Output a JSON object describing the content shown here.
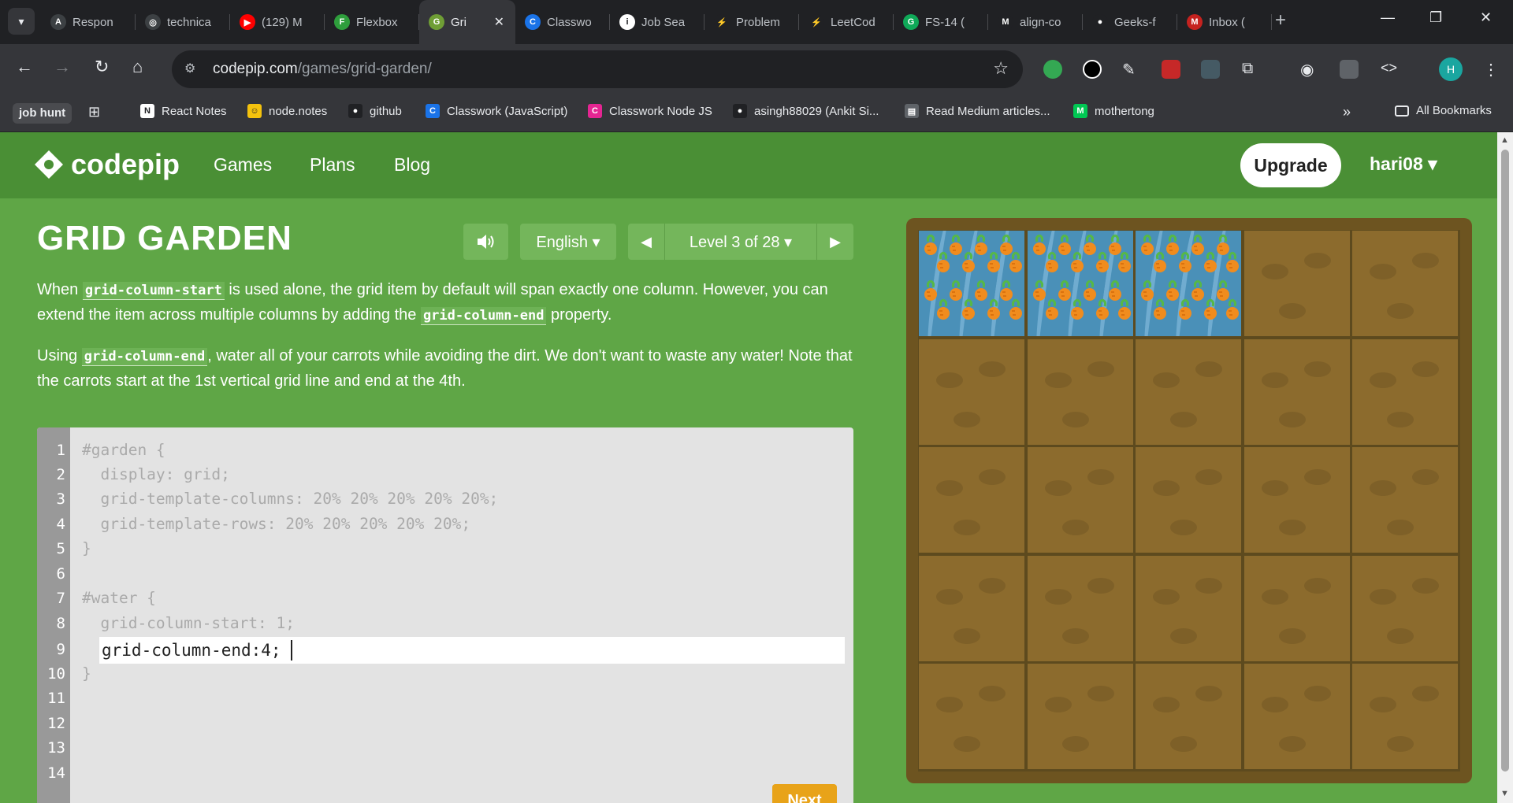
{
  "browser": {
    "tabs": [
      {
        "title": "Respon",
        "fav_color": "#3c4043",
        "fav_glyph": "A"
      },
      {
        "title": "technica",
        "fav_color": "#3c4043",
        "fav_glyph": "◎"
      },
      {
        "title": "(129) M",
        "fav_color": "#ff0000",
        "fav_glyph": "▶"
      },
      {
        "title": "Flexbox",
        "fav_color": "#2e9e3c",
        "fav_glyph": "F"
      },
      {
        "title": "Gri",
        "fav_color": "#6f9e35",
        "fav_glyph": "G",
        "active": true
      },
      {
        "title": "Classwo",
        "fav_color": "#1a73e8",
        "fav_glyph": "C"
      },
      {
        "title": "Job Sea",
        "fav_color": "#ffffff",
        "fav_glyph": "i"
      },
      {
        "title": "Problem",
        "fav_color": "#202124",
        "fav_glyph": "⚡"
      },
      {
        "title": "LeetCod",
        "fav_color": "#202124",
        "fav_glyph": "⚡"
      },
      {
        "title": "FS-14 (",
        "fav_color": "#0fa958",
        "fav_glyph": "G"
      },
      {
        "title": "align-co",
        "fav_color": "#202124",
        "fav_glyph": "M"
      },
      {
        "title": "Geeks-f",
        "fav_color": "#202124",
        "fav_glyph": "●"
      },
      {
        "title": "Inbox (",
        "fav_color": "#c5221f",
        "fav_glyph": "M"
      }
    ],
    "tab_close": "✕",
    "new_tab": "+",
    "url_host": "codepip.com",
    "url_path": "/games/grid-garden/",
    "avatar_letter": "H",
    "bookmarks": {
      "chip": "job hunt",
      "items": [
        {
          "label": "React Notes",
          "color": "#ffffff",
          "glyph": "N"
        },
        {
          "label": "node.notes",
          "color": "#f4c20d",
          "glyph": "☺"
        },
        {
          "label": "github",
          "color": "#202124",
          "glyph": "●"
        },
        {
          "label": "Classwork  (JavaScript)",
          "color": "#1a73e8",
          "glyph": "C"
        },
        {
          "label": "Classwork  Node JS",
          "color": "#e52592",
          "glyph": "C"
        },
        {
          "label": "asingh88029 (Ankit Si...",
          "color": "#202124",
          "glyph": "●"
        },
        {
          "label": "Read Medium articles...",
          "color": "#5f6368",
          "glyph": "▤"
        },
        {
          "label": "mothertong",
          "color": "#00c853",
          "glyph": "M"
        }
      ],
      "all_bookmarks": "All Bookmarks"
    }
  },
  "site": {
    "logo_text": "codepip",
    "nav": [
      "Games",
      "Plans",
      "Blog"
    ],
    "upgrade": "Upgrade",
    "user": "hari08 ▾"
  },
  "game": {
    "title": "GRID GARDEN",
    "language": "English ▾",
    "level": "Level 3 of 28 ▾",
    "para1": {
      "t1": "When ",
      "code1": "grid-column-start",
      "t2": " is used alone, the grid item by default will span exactly one column. However, you can extend the item across multiple columns by adding the ",
      "code2": "grid-column-end",
      "t3": " property."
    },
    "para2": {
      "t1": "Using ",
      "code1": "grid-column-end",
      "t2": ", water all of your carrots while avoiding the dirt. We don't want to waste any water! Note that the carrots start at the 1st vertical grid line and end at the 4th."
    },
    "line_numbers": [
      "1",
      "2",
      "3",
      "4",
      "5",
      "6",
      "7",
      "8",
      "9",
      "10",
      "11",
      "12",
      "13",
      "14"
    ],
    "code_lines": [
      "#garden {",
      "  display: grid;",
      "  grid-template-columns: 20% 20% 20% 20% 20%;",
      "  grid-template-rows: 20% 20% 20% 20% 20%;",
      "}",
      "",
      "#water {",
      "  grid-column-start: 1;",
      "",
      "}"
    ],
    "input_value": "grid-column-end:4;",
    "next_label": "Next",
    "board": {
      "rows": 5,
      "cols": 5,
      "water_row": 1,
      "water_col_start": 1,
      "water_col_end": 4
    }
  }
}
